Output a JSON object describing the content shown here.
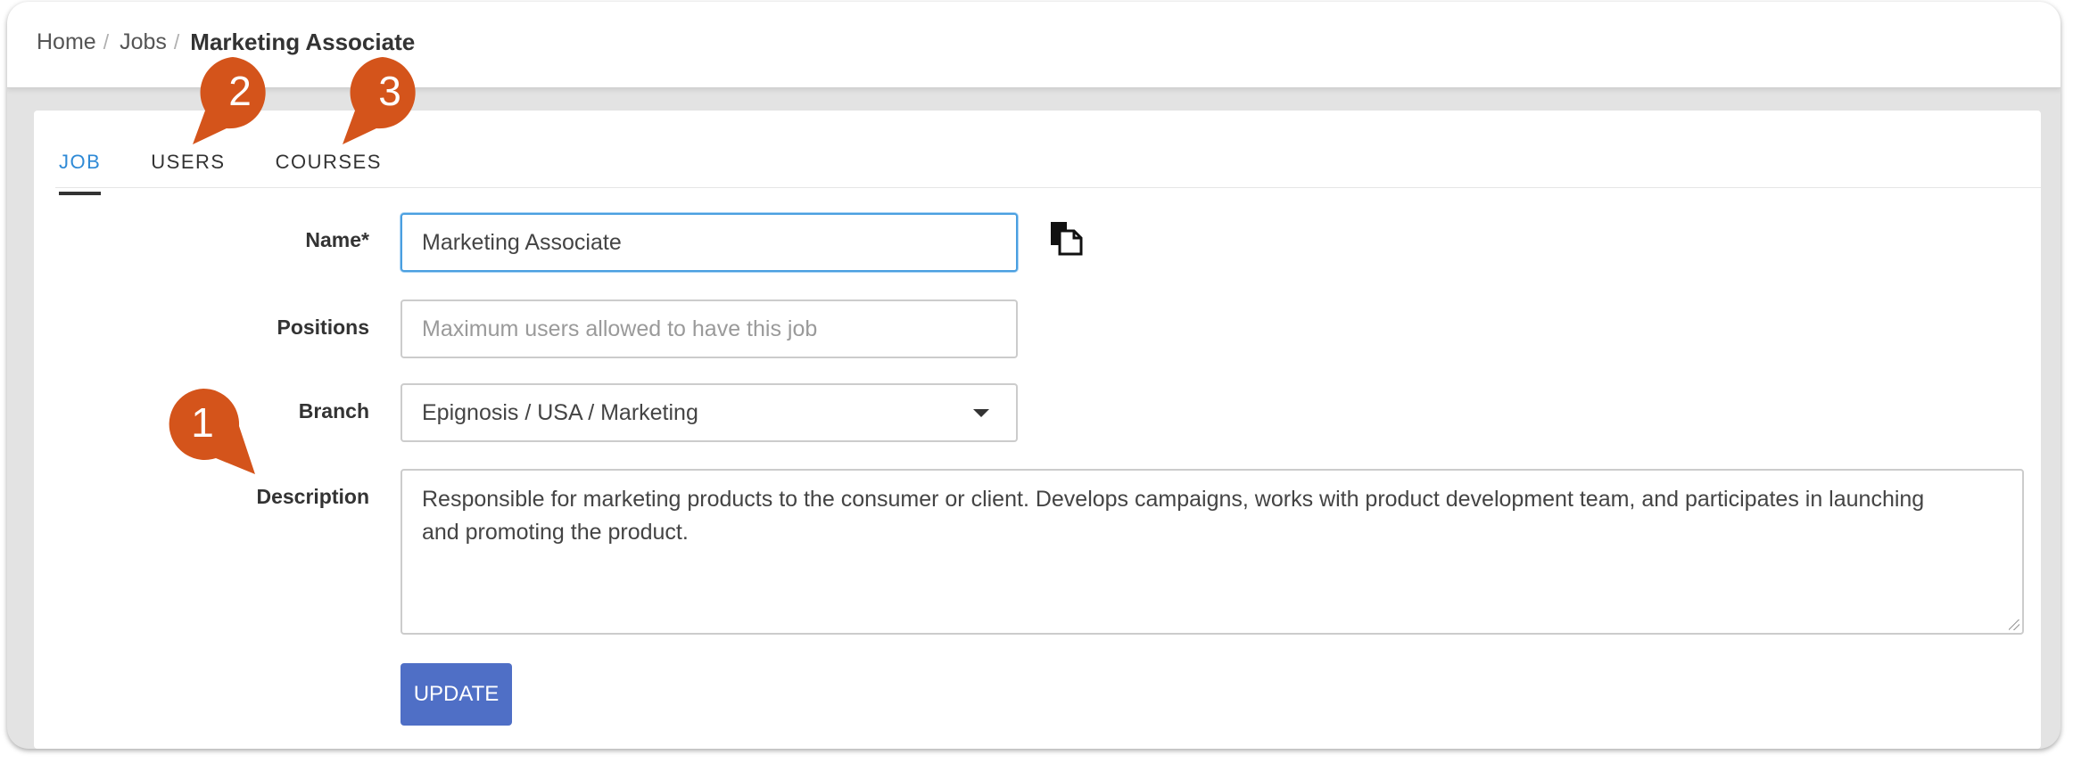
{
  "breadcrumb": {
    "items": [
      "Home",
      "Jobs"
    ],
    "separator": "/",
    "current": "Marketing Associate"
  },
  "tabs": [
    {
      "label": "JOB",
      "active": true
    },
    {
      "label": "USERS",
      "active": false
    },
    {
      "label": "COURSES",
      "active": false
    }
  ],
  "form": {
    "name": {
      "label": "Name*",
      "value": "Marketing Associate"
    },
    "positions": {
      "label": "Positions",
      "placeholder": "Maximum users allowed to have this job"
    },
    "branch": {
      "label": "Branch",
      "value": "Epignosis / USA / Marketing"
    },
    "description": {
      "label": "Description",
      "value": "Responsible for marketing products to the consumer or client. Develops campaigns, works with product development team, and participates in launching and promoting the product."
    },
    "update_label": "UPDATE"
  },
  "callouts": [
    "1",
    "2",
    "3"
  ],
  "colors": {
    "accent": "#2f8ad6",
    "button": "#4f6fc6",
    "callout": "#d4541b"
  },
  "icons": {
    "copy": "copy-icon",
    "branch_dropdown": "caret-down-icon"
  }
}
